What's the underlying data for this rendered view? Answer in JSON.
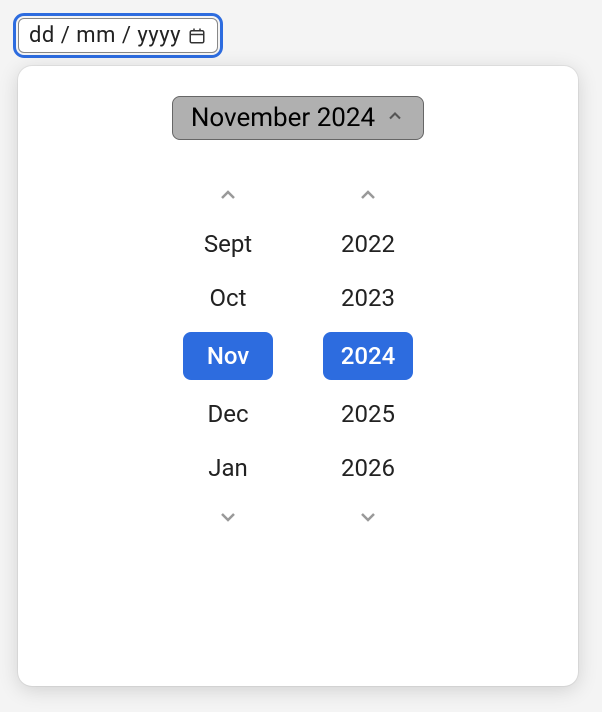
{
  "input": {
    "placeholder": "dd / mm / yyyy"
  },
  "header": {
    "label": "November 2024"
  },
  "months": {
    "items": [
      "Sept",
      "Oct",
      "Nov",
      "Dec",
      "Jan"
    ],
    "selectedIndex": 2
  },
  "years": {
    "items": [
      "2022",
      "2023",
      "2024",
      "2025",
      "2026"
    ],
    "selectedIndex": 2
  }
}
